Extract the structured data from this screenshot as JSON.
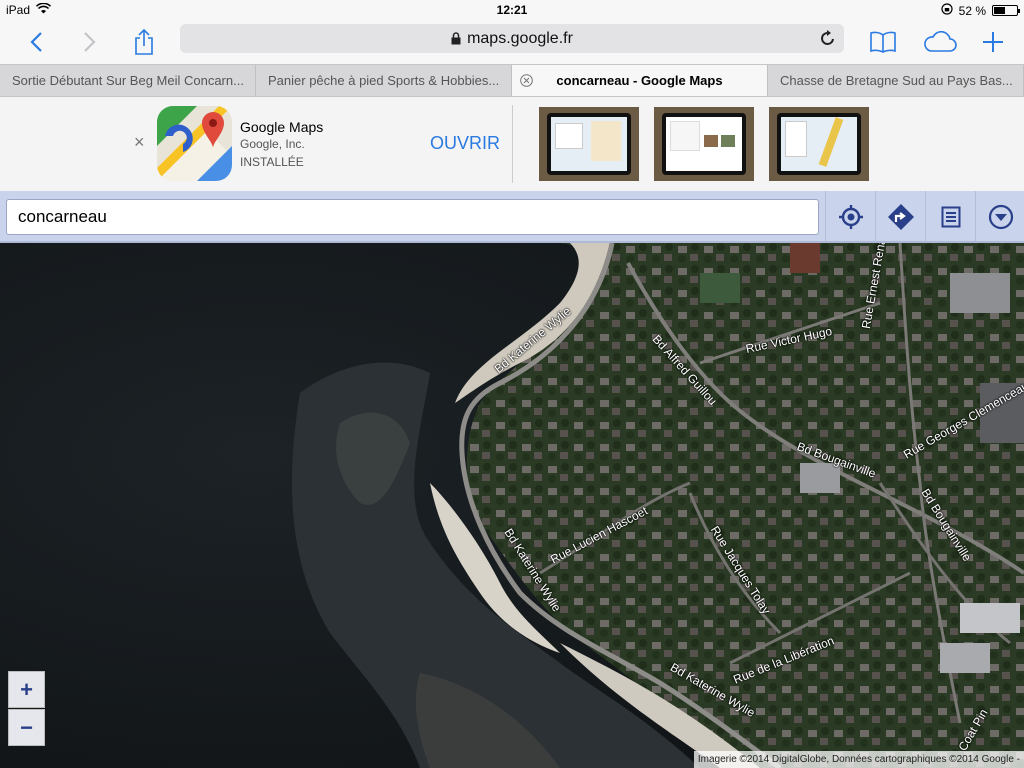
{
  "status_bar": {
    "device": "iPad",
    "time": "12:21",
    "battery": "52 %",
    "battery_level": 0.52
  },
  "browser": {
    "url": "maps.google.fr",
    "tabs": [
      {
        "title": "Sortie Débutant Sur Beg Meil Concarn..."
      },
      {
        "title": "Panier pêche à pied Sports & Hobbies..."
      },
      {
        "title": "concarneau - Google Maps",
        "active": true
      },
      {
        "title": "Chasse de Bretagne Sud au Pays Bas..."
      }
    ]
  },
  "app_banner": {
    "name": "Google Maps",
    "developer": "Google, Inc.",
    "state": "INSTALLÉE",
    "action": "OUVRIR",
    "close_glyph": "×"
  },
  "maps": {
    "search_value": "concarneau",
    "zoom_in": "+",
    "zoom_out": "−",
    "attribution": "Imagerie ©2014 DigitalGlobe, Données cartographiques ©2014 Google -",
    "streets": [
      "Bd Katerine Wylie",
      "Bd Alfred Guillou",
      "Rue Victor Hugo",
      "Bd Bougainville",
      "Rue Georges Clemenceau",
      "Rue Lucien Hascoet",
      "Rue Jacques Tolay",
      "Bd Katerine Wylie",
      "Rue de la Libération",
      "Bd Katerine Wylie",
      "Bd Bougainville",
      "Rue Ernest Renan",
      "Coat Pin"
    ]
  },
  "colors": {
    "accent": "#2a7ae2",
    "map_toolbar": "#c9d3ec",
    "map_icon": "#2a3f8a"
  }
}
